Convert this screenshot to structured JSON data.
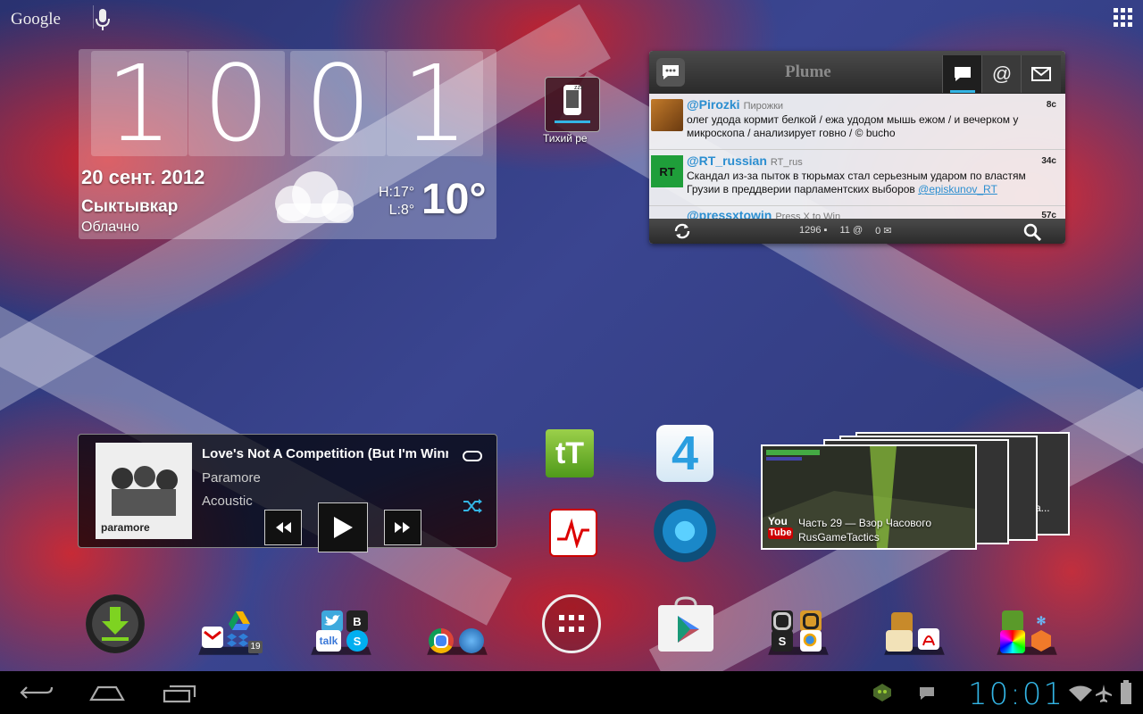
{
  "search": {
    "logo": "Google",
    "mic_icon": "microphone-icon"
  },
  "clock_widget": {
    "digits": [
      "1",
      "0",
      "0",
      "1"
    ],
    "date": "20 сент. 2012",
    "city": "Сыктывкар",
    "condition": "Облачно",
    "high": "H:17°",
    "low": "L:8°",
    "temperature": "10°"
  },
  "silent_shortcut": {
    "label": "Тихий ре"
  },
  "plume": {
    "title": "Plume",
    "tabs": [
      "timeline-tab",
      "mentions-tab",
      "messages-tab"
    ],
    "mentions_symbol": "@",
    "tweets": [
      {
        "user": "@Pirozki",
        "name": "Пирожки",
        "time": "8с",
        "text": "олег удода кормит белкой / ежа удодом мышь ежом / и вечерком у микроскопа / анализирует говно / © bucho",
        "mention": ""
      },
      {
        "user": "@RT_russian",
        "name": "RT_rus",
        "time": "34с",
        "text": "Скандал из-за пыток в тюрьмах стал серьезным ударом по властям Грузии в преддверии парламентских выборов",
        "mention": "@episkunov_RT"
      },
      {
        "user": "@pressxtowin",
        "name": "Press X to Win",
        "time": "57с",
        "text": "",
        "mention": ""
      }
    ],
    "avatar_rt_text": "RT",
    "footer": {
      "tweets_count": "1296",
      "mentions_count": "11",
      "messages_count": "0"
    }
  },
  "music": {
    "song": "Love's Not A Competition (But I'm Winning)",
    "artist": "Paramore",
    "album": "Acoustic",
    "album_art_text": "paramore"
  },
  "apps": {
    "tt_label": "tT",
    "four_label": "4"
  },
  "youtube": {
    "video_title": "Часть 29 — Взор Часового",
    "channel": "RusGameTactics",
    "stack_label": "ива...",
    "logo_you": "You",
    "logo_tube": "Tube"
  },
  "dock": {
    "folder2_badge": "19",
    "talk_label": "talk",
    "beeline_label": "B"
  },
  "status": {
    "time": "10:01"
  },
  "colors": {
    "accent": "#33b5e5",
    "plume_link": "#2b8ed0",
    "red": "#d8262c",
    "blue": "#2f3a80"
  }
}
